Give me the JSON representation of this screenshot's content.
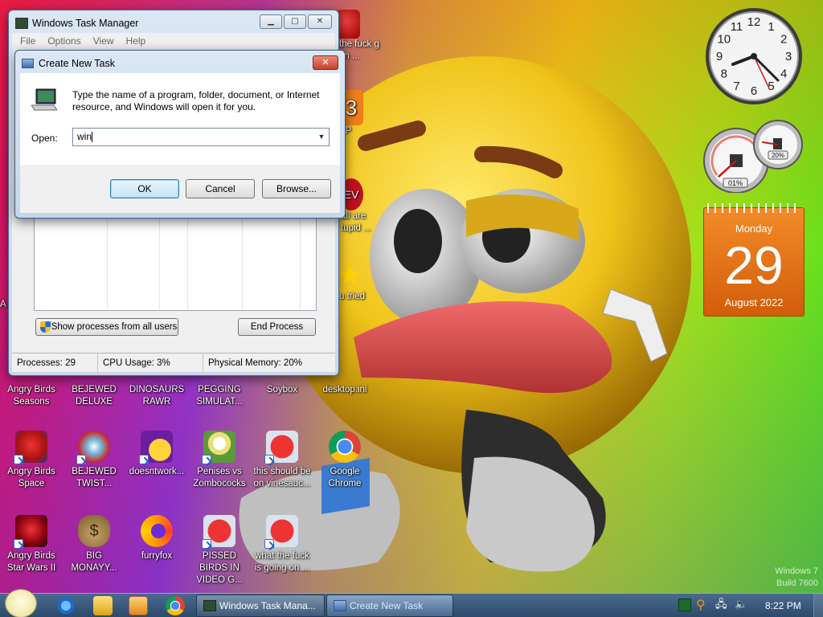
{
  "colors": {
    "taskbar": "#3a5a7d",
    "calendar": "#e56f12",
    "dialog_ok": "#c4e3f7"
  },
  "desktop_icons": [
    {
      "label": "Angry Birds Seasons",
      "icon": "angry-birds-icon"
    },
    {
      "label": "BEJEWED DELUXE",
      "icon": "bejeweled-icon"
    },
    {
      "label": "DINOSAURS RAWR",
      "icon": "dinosaur-icon"
    },
    {
      "label": "PEGGING SIMULAT...",
      "icon": "game-icon"
    },
    {
      "label": "Soybox",
      "icon": "app-icon"
    },
    {
      "label": "desktop.ini",
      "icon": "file-icon"
    },
    {
      "label": "Angry Birds Space",
      "icon": "angry-birds-icon"
    },
    {
      "label": "BEJEWED TWIST...",
      "icon": "bejeweled-icon"
    },
    {
      "label": "doesntwork...",
      "icon": "yahoo-icon"
    },
    {
      "label": "Penises vs Zombococks",
      "icon": "plants-icon"
    },
    {
      "label": "this should be on vinesauc...",
      "icon": "angry-birds-icon"
    },
    {
      "label": "Google Chrome",
      "icon": "chrome-icon"
    },
    {
      "label": "Angry Birds Star Wars II",
      "icon": "angry-birds-icon"
    },
    {
      "label": "BIG MONAYY...",
      "icon": "money-bag-icon"
    },
    {
      "label": "furryfox",
      "icon": "firefox-icon"
    },
    {
      "label": "PISSED BIRDS IN VIDEO G...",
      "icon": "angry-birds-icon"
    },
    {
      "label": "what the fuck is going on ...",
      "icon": "angry-birds-icon"
    }
  ],
  "partial_icons": [
    {
      "label": "the fuck g on ..."
    },
    {
      "label": "PP"
    },
    {
      "label": "all are tupid ..."
    },
    {
      "label": "u tried"
    },
    {
      "label": "A"
    }
  ],
  "task_manager": {
    "title": "Windows Task Manager",
    "menu": [
      "File",
      "Options",
      "View",
      "Help"
    ],
    "show_all_button": "Show processes from all users",
    "end_process_button": "End Process",
    "status": {
      "processes": "Processes: 29",
      "cpu": "CPU Usage: 3%",
      "memory": "Physical Memory: 20%"
    }
  },
  "create_task": {
    "title": "Create New Task",
    "message": "Type the name of a program, folder, document, or Internet resource, and Windows will open it for you.",
    "open_label": "Open:",
    "open_value": "win",
    "ok": "OK",
    "cancel": "Cancel",
    "browse": "Browse..."
  },
  "gadgets": {
    "clock_numbers": [
      "12",
      "1",
      "2",
      "3",
      "4",
      "5",
      "6",
      "7",
      "8",
      "9",
      "10",
      "11"
    ],
    "cpu_percent": "01%",
    "mem_percent": "20%",
    "cpu_value": 0.01,
    "mem_value": 0.2,
    "calendar": {
      "weekday": "Monday",
      "day": "29",
      "month_year": "August 2022"
    }
  },
  "watermark": {
    "line1": "Windows 7",
    "line2": "Build 7600"
  },
  "taskbar": {
    "buttons": [
      {
        "label": "Windows Task Mana..."
      },
      {
        "label": "Create New Task"
      }
    ],
    "time": "8:22 PM"
  }
}
